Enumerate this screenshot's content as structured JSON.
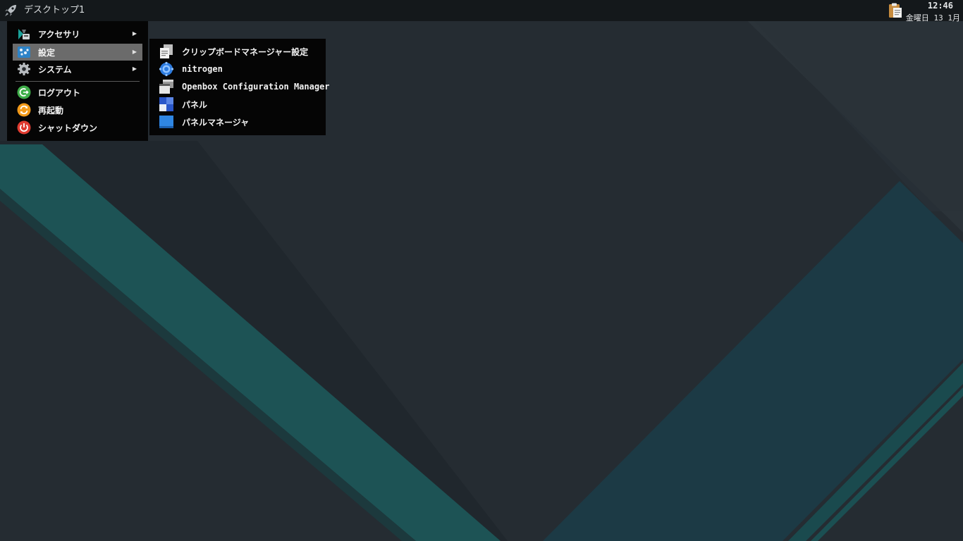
{
  "panel": {
    "launcher_icon": "rocket-icon",
    "desktop_name": "デスクトップ1",
    "clipboard_icon": "clipboard-icon",
    "clock_time": "12:46",
    "clock_date": "金曜日 13 1月"
  },
  "main_menu": {
    "items": [
      {
        "label": "アクセサリ",
        "icon": "accessories-icon",
        "has_submenu": true
      },
      {
        "label": "設定",
        "icon": "settings-icon",
        "has_submenu": true,
        "active": true
      },
      {
        "label": "システム",
        "icon": "system-gear-icon",
        "has_submenu": true
      },
      {
        "label": "ログアウト",
        "icon": "logout-icon"
      },
      {
        "label": "再起動",
        "icon": "reboot-icon"
      },
      {
        "label": "シャットダウン",
        "icon": "shutdown-icon"
      }
    ],
    "arrow": "▶"
  },
  "settings_submenu": {
    "items": [
      {
        "label": "クリップボードマネージャー設定",
        "icon": "clipboard-manager-icon"
      },
      {
        "label": "nitrogen",
        "icon": "nitrogen-icon"
      },
      {
        "label": "Openbox Configuration Manager",
        "icon": "openbox-window-icon"
      },
      {
        "label": "パネル",
        "icon": "panel-icon"
      },
      {
        "label": "パネルマネージャ",
        "icon": "panel-manager-icon"
      }
    ]
  },
  "colors": {
    "panel_bg": "#14181b",
    "menu_bg": "#050505",
    "menu_active_bg": "#6b6b6b",
    "wallpaper_dark": "#262d33",
    "wallpaper_teal": "#1e5656",
    "wallpaper_blue_teal": "#1d3a44"
  }
}
